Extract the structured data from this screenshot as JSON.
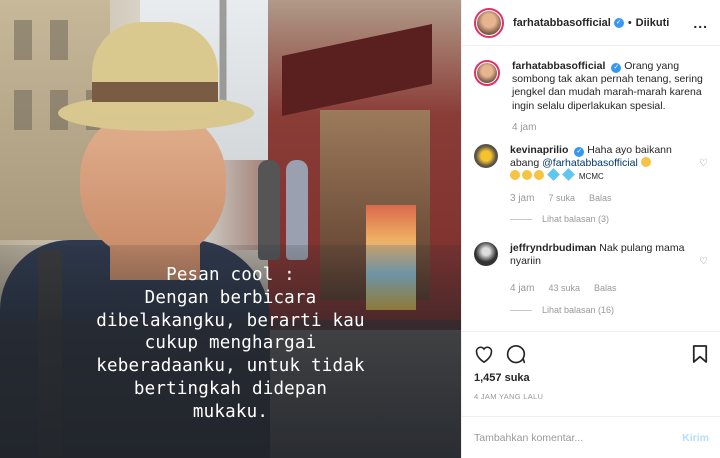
{
  "photo": {
    "caption": "Pesan cool :\nDengan berbicara\ndibelakangku, berarti kau\ncukup menghargai\nkeberadaanku, untuk tidak\nbertingkah didepan\nmukaku."
  },
  "header": {
    "username": "farhatabbasofficial",
    "separator": "•",
    "follow_status": "Diikuti",
    "more": "..."
  },
  "caption_post": {
    "username": "farhatabbasofficial",
    "text": "Orang yang sombong tak akan pernah tenang, sering jengkel dan mudah marah-marah karena ingin selalu diperlakukan spesial.",
    "time": "4 jam"
  },
  "comments": [
    {
      "username": "kevinaprilio",
      "text_before": "Haha ayo baikann abang",
      "mention": "@farhatabbasofficial",
      "text_after": "MCMC",
      "time": "3 jam",
      "likes": "7 suka",
      "reply": "Balas",
      "view_replies": "Lihat balasan (3)"
    },
    {
      "username": "jeffryndrbudiman",
      "text": "Nak pulang mama nyariin",
      "time": "4 jam",
      "likes": "43 suka",
      "reply": "Balas",
      "view_replies": "Lihat balasan (16)"
    }
  ],
  "actions": {
    "likes": "1,457 suka",
    "timestamp": "4 JAM YANG LALU"
  },
  "add_comment": {
    "placeholder": "Tambahkan komentar...",
    "submit": "Kirim"
  },
  "colors": {
    "verified": "#3897f0",
    "submit_disabled": "#b2dffc",
    "mention": "#00376b"
  }
}
